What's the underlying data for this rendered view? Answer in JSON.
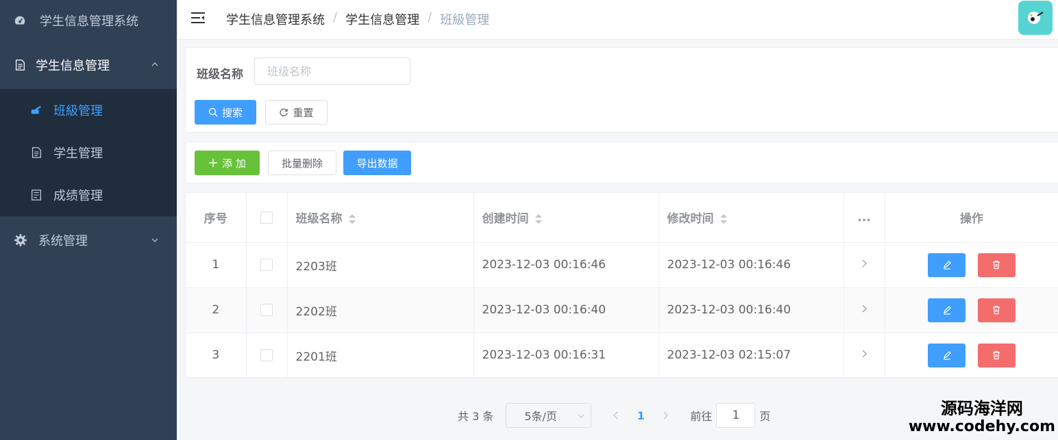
{
  "sidebar": {
    "brand": "学生信息管理系统",
    "menu": "学生信息管理",
    "items": [
      {
        "label": "班級管理"
      },
      {
        "label": "学生管理"
      },
      {
        "label": "成绩管理"
      }
    ],
    "system": "系统管理"
  },
  "header": {
    "breadcrumb": [
      "学生信息管理系统",
      "学生信息管理",
      "班級管理"
    ],
    "sep": "/"
  },
  "search": {
    "label": "班级名称",
    "placeholder": "班级名称",
    "search_label": "搜索",
    "reset_label": "重置"
  },
  "toolbar": {
    "add_label": "添 加",
    "batch_delete_label": "批量删除",
    "export_label": "导出数据"
  },
  "table": {
    "columns": {
      "index": "序号",
      "name": "班级名称",
      "created": "创建时间",
      "modified": "修改时间",
      "more": "...",
      "actions": "操作"
    },
    "rows": [
      {
        "index": "1",
        "name": "2203班",
        "created": "2023-12-03 00:16:46",
        "modified": "2023-12-03 00:16:46"
      },
      {
        "index": "2",
        "name": "2202班",
        "created": "2023-12-03 00:16:40",
        "modified": "2023-12-03 00:16:40"
      },
      {
        "index": "3",
        "name": "2201班",
        "created": "2023-12-03 00:16:31",
        "modified": "2023-12-03 02:15:07"
      }
    ]
  },
  "pagination": {
    "total": "共 3 条",
    "page_size": "5条/页",
    "current": "1",
    "goto": "前往",
    "goto_value": "1",
    "page_unit": "页"
  },
  "watermark": {
    "name": "源码海洋网",
    "url": "www.codehy.com"
  },
  "colors": {
    "sidebar_bg": "#304156",
    "submenu_bg": "#1f2d3d",
    "primary": "#409eff",
    "success": "#67c23a",
    "danger": "#f56c6c"
  }
}
